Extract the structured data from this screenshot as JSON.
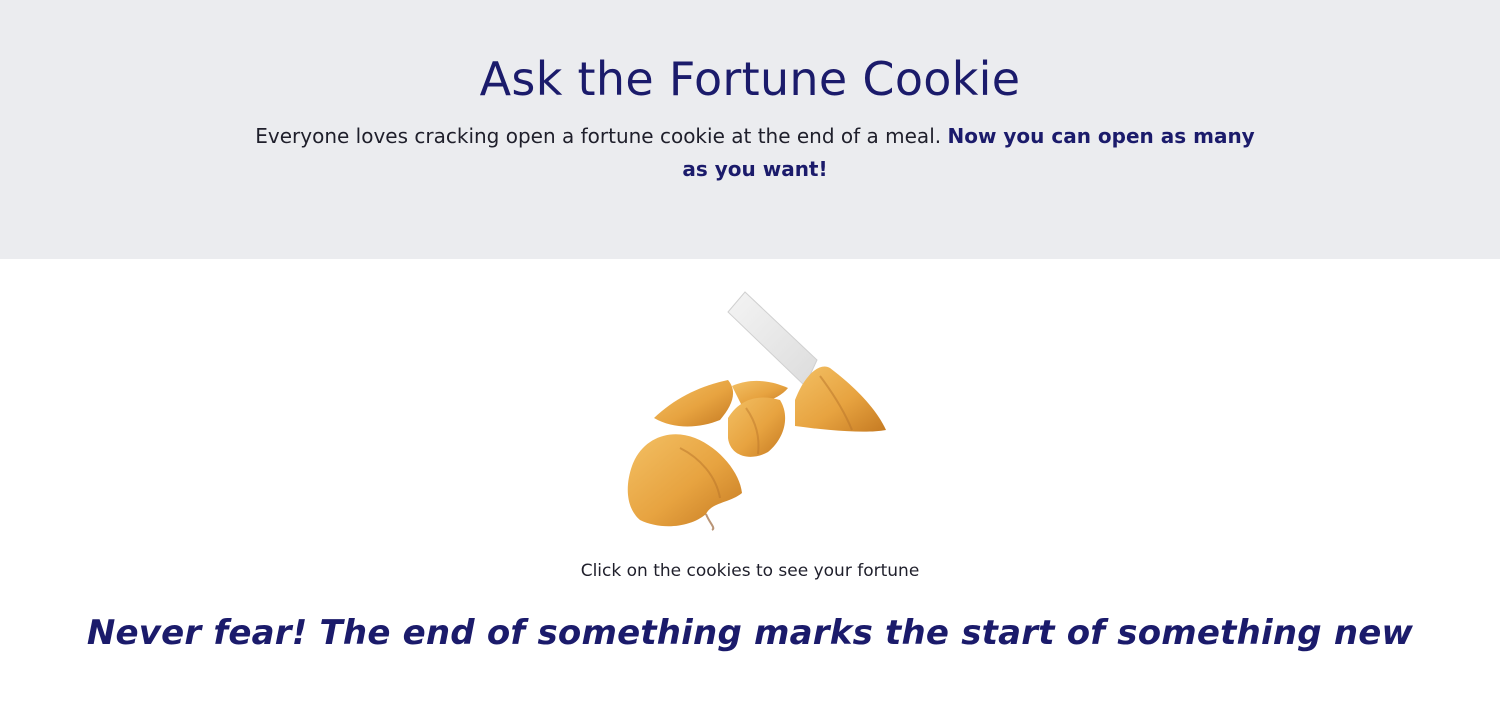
{
  "header": {
    "title": "Ask the Fortune Cookie",
    "intro_plain": "Everyone loves cracking open a fortune cookie at the end of a meal. ",
    "intro_bold": "Now you can open as many as you want!"
  },
  "cookie": {
    "icon": "fortune-cookies-image",
    "instructions": "Click on the cookies to see your fortune"
  },
  "fortune": {
    "text": "Never fear! The end of something marks the start of something new"
  },
  "colors": {
    "accent": "#1b1b6b",
    "hero_background": "#ebecef",
    "cookie": "#e7a340"
  }
}
